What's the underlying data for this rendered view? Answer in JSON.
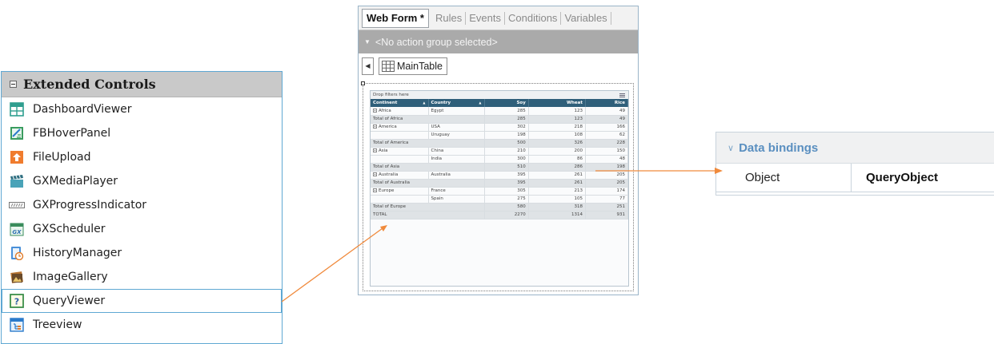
{
  "toolbox": {
    "title": "Extended Controls",
    "items": [
      {
        "label": "DashboardViewer",
        "icon": "dashboard-icon"
      },
      {
        "label": "FBHoverPanel",
        "icon": "hover-panel-icon"
      },
      {
        "label": "FileUpload",
        "icon": "upload-icon"
      },
      {
        "label": "GXMediaPlayer",
        "icon": "clapper-icon"
      },
      {
        "label": "GXProgressIndicator",
        "icon": "progress-icon"
      },
      {
        "label": "GXScheduler",
        "icon": "calendar-icon"
      },
      {
        "label": "HistoryManager",
        "icon": "history-icon"
      },
      {
        "label": "ImageGallery",
        "icon": "gallery-icon"
      },
      {
        "label": "QueryViewer",
        "icon": "query-icon"
      },
      {
        "label": "Treeview",
        "icon": "tree-icon"
      }
    ],
    "selected_index": 8
  },
  "designer": {
    "tabs": [
      "Web Form *",
      "Rules",
      "Events",
      "Conditions",
      "Variables"
    ],
    "active_tab": 0,
    "action_group": "<No action group selected>",
    "breadcrumb": "MainTable",
    "pivot": {
      "drop_label": "Drop filters here",
      "columns": [
        "Continent",
        "Country",
        "Soy",
        "Wheat",
        "Rice"
      ],
      "rows": [
        {
          "type": "data",
          "continent": "Africa",
          "country": "Egypt",
          "soy": "285",
          "wheat": "123",
          "rice": "49"
        },
        {
          "type": "total",
          "label": "Total of Africa",
          "soy": "285",
          "wheat": "123",
          "rice": "49"
        },
        {
          "type": "data",
          "continent": "America",
          "country": "USA",
          "soy": "302",
          "wheat": "218",
          "rice": "166"
        },
        {
          "type": "data",
          "continent": "",
          "country": "Uruguay",
          "soy": "198",
          "wheat": "108",
          "rice": "62"
        },
        {
          "type": "total",
          "label": "Total of America",
          "soy": "500",
          "wheat": "326",
          "rice": "228"
        },
        {
          "type": "data",
          "continent": "Asia",
          "country": "China",
          "soy": "210",
          "wheat": "200",
          "rice": "150"
        },
        {
          "type": "data",
          "continent": "",
          "country": "India",
          "soy": "300",
          "wheat": "86",
          "rice": "48"
        },
        {
          "type": "total",
          "label": "Total of Asia",
          "soy": "510",
          "wheat": "286",
          "rice": "198"
        },
        {
          "type": "data",
          "continent": "Australia",
          "country": "Australia",
          "soy": "395",
          "wheat": "261",
          "rice": "205"
        },
        {
          "type": "total",
          "label": "Total of Australia",
          "soy": "395",
          "wheat": "261",
          "rice": "205"
        },
        {
          "type": "data",
          "continent": "Europe",
          "country": "France",
          "soy": "305",
          "wheat": "213",
          "rice": "174"
        },
        {
          "type": "data",
          "continent": "",
          "country": "Spain",
          "soy": "275",
          "wheat": "105",
          "rice": "77"
        },
        {
          "type": "total",
          "label": "Total of Europe",
          "soy": "580",
          "wheat": "318",
          "rice": "251"
        },
        {
          "type": "total",
          "label": "TOTAL",
          "soy": "2270",
          "wheat": "1314",
          "rice": "931"
        }
      ]
    }
  },
  "properties": {
    "group": "Data bindings",
    "rows": [
      {
        "name": "Object",
        "value": "QueryObject"
      }
    ]
  },
  "colors": {
    "accent": "#5fa8d3",
    "arrow": "#f08a3c",
    "pivot_header": "#2f5f7a",
    "props_group": "#5a8fc0"
  }
}
